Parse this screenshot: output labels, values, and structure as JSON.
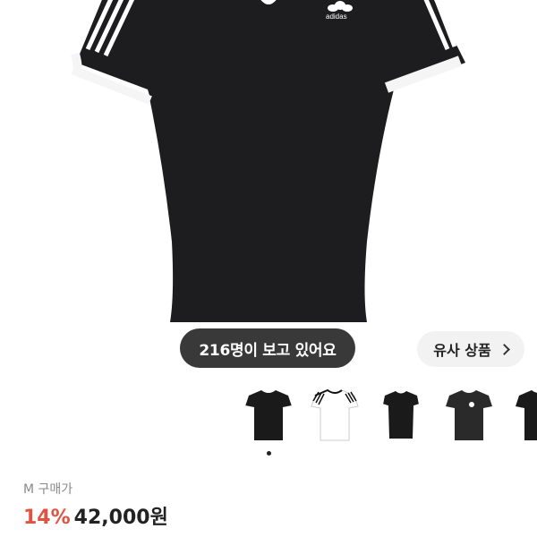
{
  "product": {
    "brand_logo_text": "adidas",
    "viewers_text": "216명이 보고 있어요",
    "similar_label": "유사 상품",
    "price_label": "M 구매가",
    "discount": "14%",
    "price": "42,000원"
  },
  "thumbnails": [
    {
      "name": "black-tee-white-stripes"
    },
    {
      "name": "white-tee-black-stripes"
    },
    {
      "name": "black-tee-slim"
    },
    {
      "name": "black-tee-logo"
    },
    {
      "name": "black-tee-partial"
    }
  ],
  "carousel": {
    "active_index": 0,
    "total": 1
  }
}
